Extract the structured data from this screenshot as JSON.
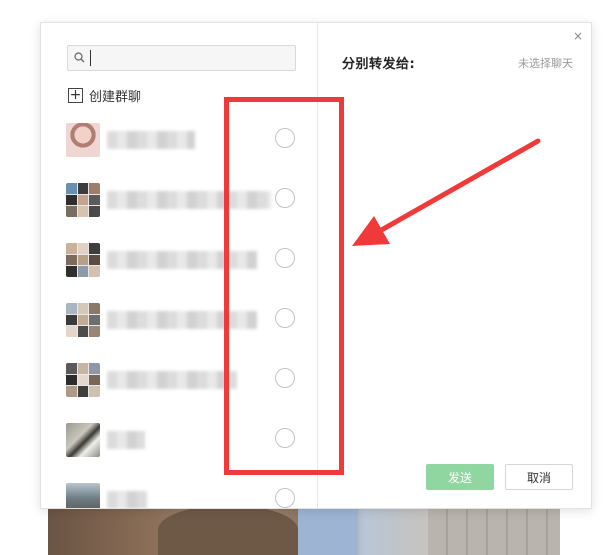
{
  "dialog": {
    "search": {
      "placeholder": ""
    },
    "create_group_label": "创建群聊",
    "contacts": [
      {
        "avatar": "girl-avatar"
      },
      {
        "avatar": "group-avatar"
      },
      {
        "avatar": "group-avatar"
      },
      {
        "avatar": "group-avatar"
      },
      {
        "avatar": "group-avatar"
      },
      {
        "avatar": "dog-avatar"
      },
      {
        "avatar": "photo-avatar"
      }
    ],
    "right": {
      "title": "分别转发给:",
      "status": "未选择聊天",
      "close": "×",
      "send_label": "发送",
      "cancel_label": "取消"
    }
  },
  "colors": {
    "annotation": "#f03a3a",
    "send_button": "#8fd6a0"
  }
}
